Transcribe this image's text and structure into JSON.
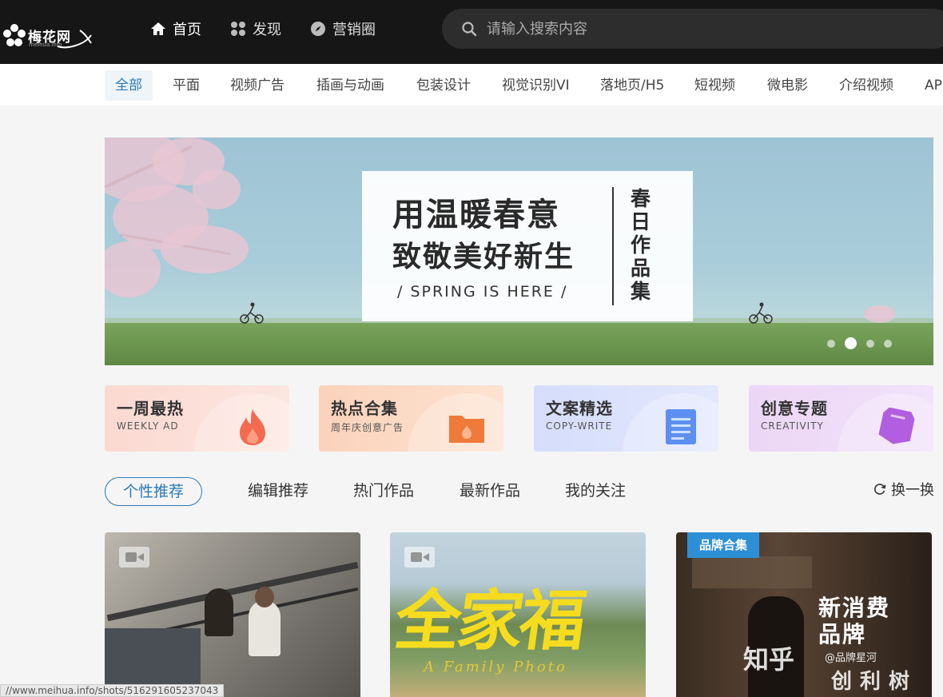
{
  "brand": {
    "name": "梅花网",
    "domain": "meihua.info"
  },
  "topnav": [
    {
      "label": "首页",
      "icon": "home-icon"
    },
    {
      "label": "发现",
      "icon": "grid-icon"
    },
    {
      "label": "营销圈",
      "icon": "compass-icon"
    }
  ],
  "search": {
    "placeholder": "请输入搜索内容"
  },
  "categories": [
    "全部",
    "平面",
    "视频广告",
    "插画与动画",
    "包装设计",
    "视觉识别VI",
    "落地页/H5",
    "短视频",
    "微电影",
    "介绍视频",
    "APP"
  ],
  "banner": {
    "line1": "用温暖春意",
    "line2": "致敬美好新生",
    "english": "/ SPRING IS HERE /",
    "vertical": "春日作品集",
    "slide_count": 4,
    "active_slide": 2
  },
  "features": [
    {
      "title": "一周最热",
      "subtitle": "WEEKLY AD",
      "icon": "fire-icon"
    },
    {
      "title": "热点合集",
      "subtitle": "周年庆创意广告",
      "icon": "folder-icon"
    },
    {
      "title": "文案精选",
      "subtitle": "COPY-WRITE",
      "icon": "document-icon"
    },
    {
      "title": "创意专题",
      "subtitle": "CREATIVITY",
      "icon": "pen-icon"
    }
  ],
  "tabs": [
    "个性推荐",
    "编辑推荐",
    "热门作品",
    "最新作品",
    "我的关注"
  ],
  "refresh_label": "换一换",
  "thumbs": [
    {
      "type": "video"
    },
    {
      "type": "video",
      "title": "全家福",
      "subtitle": "A Family Photo"
    },
    {
      "type": "collection",
      "badge": "品牌合集",
      "title": "新消费\n品牌"
    }
  ],
  "status_url": "//www.meihua.info/shots/516291605237043",
  "watermark": {
    "zhihu": "知乎",
    "handle": "@品牌星河",
    "brand": "创利树"
  },
  "colors": {
    "accent": "#2b7ab8",
    "topbar": "#161616",
    "badge": "#2d8fd5"
  }
}
